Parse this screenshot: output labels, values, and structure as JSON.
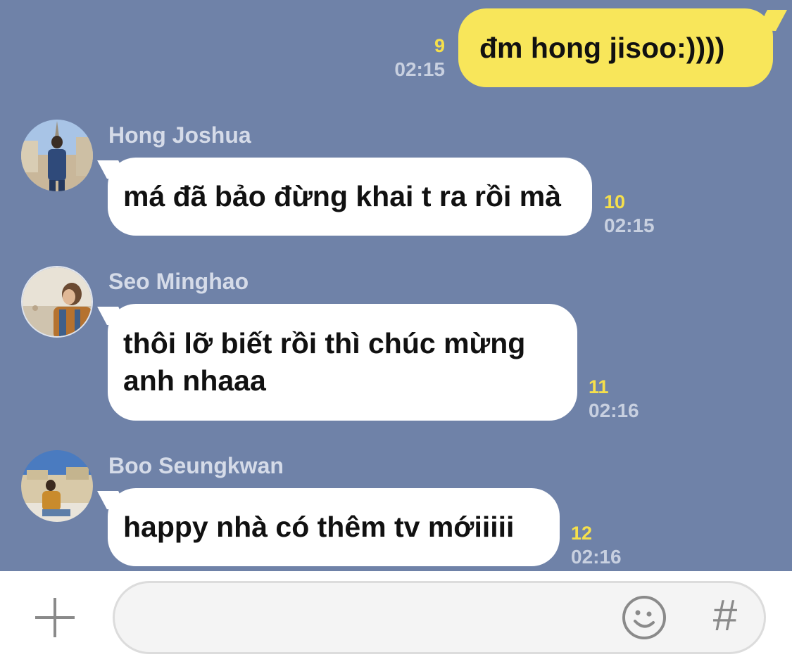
{
  "outgoing": {
    "text": "đm hong jisoo:))))",
    "read_count": "9",
    "time": "02:15"
  },
  "messages": [
    {
      "sender": "Hong Joshua",
      "text": "má đã bảo đừng khai t ra rồi mà",
      "read_count": "10",
      "time": "02:15"
    },
    {
      "sender": "Seo Minghao",
      "lines": [
        "thôi lỡ biết rồi thì chúc mừng",
        "anh nhaaa"
      ],
      "read_count": "11",
      "time": "02:16"
    },
    {
      "sender": "Boo Seungkwan",
      "text": "happy nhà có thêm tv mớiiiii",
      "read_count": "12",
      "time": "02:16"
    }
  ],
  "input_bar": {
    "plus_icon": "plus-icon",
    "emoji_icon": "emoji-icon",
    "hash_label": "#"
  },
  "colors": {
    "chat_background": "#6f82a8",
    "outgoing_bubble": "#f8e65a",
    "incoming_bubble": "#ffffff",
    "read_count": "#f6e04b"
  }
}
